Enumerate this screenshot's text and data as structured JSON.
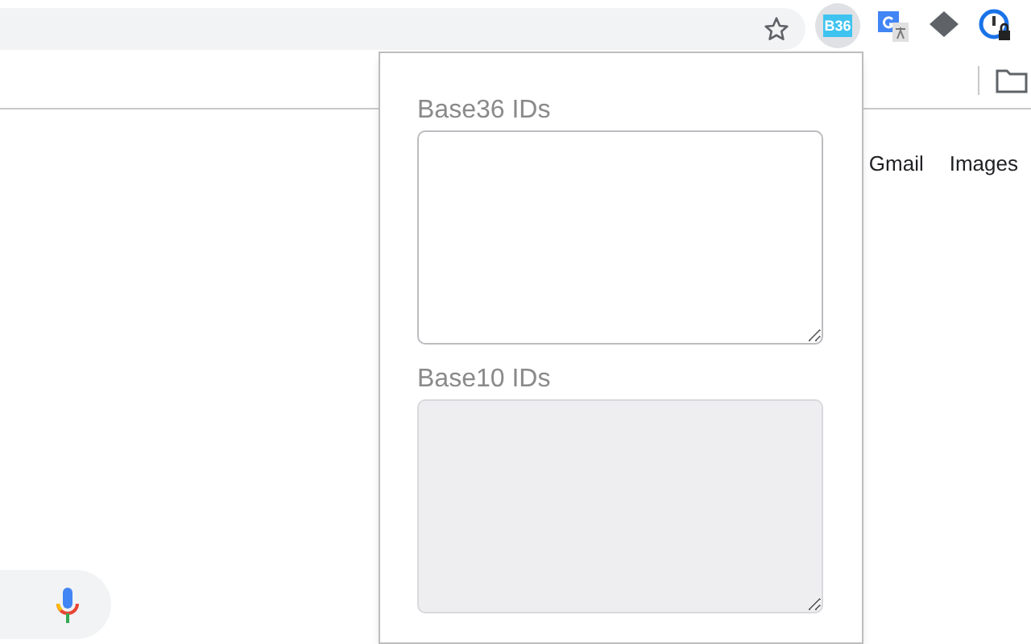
{
  "toolbar": {
    "extension_badge": "B36"
  },
  "header_links": [
    "Gmail",
    "Images"
  ],
  "popup": {
    "fields": [
      {
        "label": "Base36 IDs",
        "disabled": false
      },
      {
        "label": "Base10 IDs",
        "disabled": true
      }
    ]
  }
}
